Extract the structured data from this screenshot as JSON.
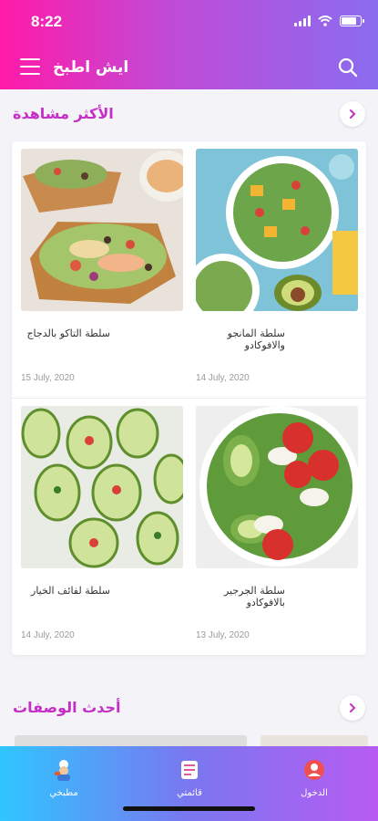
{
  "status_bar": {
    "time": "8:22"
  },
  "app_bar": {
    "title": "ايش اطبخ"
  },
  "most_viewed": {
    "title": "الأكثر مشاهدة",
    "recipes": [
      {
        "name": "سلطة التاكو بالدجاج",
        "date": "15 July, 2020"
      },
      {
        "name": "سلطة المانجو والافوكادو",
        "date": "14 July, 2020"
      },
      {
        "name": "سلطة لفائف الخيار",
        "date": "14 July, 2020"
      },
      {
        "name": "سلطة الجرجير بالافوكادو",
        "date": "13 July, 2020"
      }
    ]
  },
  "latest_recipes": {
    "title": "أحدث الوصفات"
  },
  "bottom_nav": {
    "items": [
      {
        "label": "مطبخي",
        "icon": "chef-icon"
      },
      {
        "label": "قائمتي",
        "icon": "list-icon"
      },
      {
        "label": "الدخول",
        "icon": "user-icon"
      }
    ]
  },
  "colors": {
    "header_start": "#ff1aa8",
    "header_end": "#8a6cf0",
    "section_title": "#c52fc7",
    "nav_start": "#2fc6ff",
    "nav_end": "#b85bf2"
  }
}
